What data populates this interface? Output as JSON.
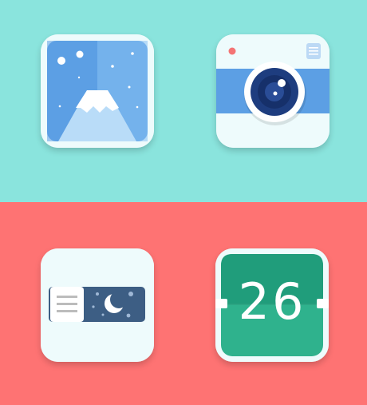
{
  "colors": {
    "top_background": "#8ae4dd",
    "bottom_background": "#fe7373",
    "icon_tile": "#eefbfc",
    "photo_sky_dark": "#5c9fe4",
    "photo_sky_light": "#89c1f3",
    "camera_band": "#5c9fe4",
    "camera_lens_dark": "#1e3d7f",
    "camera_flash": "#f47474",
    "night_panel": "#3d5e84",
    "calendar_green": "#2fb28d",
    "calendar_green_dark": "#209d7b"
  },
  "icons": {
    "photos": {
      "icon": "mountain-photo-icon"
    },
    "camera": {
      "icon": "camera-icon"
    },
    "night_mode": {
      "icon": "moon-toggle-icon"
    },
    "calendar": {
      "icon": "calendar-icon",
      "day_number": "26"
    }
  }
}
